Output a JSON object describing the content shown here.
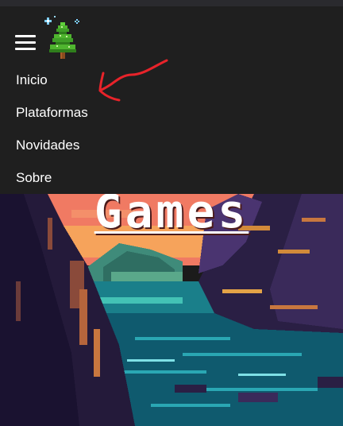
{
  "nav": {
    "menu_icon": "hamburger-menu-icon",
    "logo_icon": "pixel-pine-tree-logo",
    "items": [
      {
        "label": "Inicio"
      },
      {
        "label": "Plataformas"
      },
      {
        "label": "Novidades"
      },
      {
        "label": "Sobre"
      }
    ]
  },
  "annotation": {
    "icon": "red-hand-drawn-arrow",
    "color": "#e8232a"
  },
  "hero": {
    "title": "Games",
    "image": "pixel-art-coastal-cliffs-sunset"
  },
  "colors": {
    "nav_bg": "#1f1f1f",
    "nav_text": "#ffffff",
    "water": "#0f5a6e",
    "sky_glow": "#f6a35b"
  }
}
